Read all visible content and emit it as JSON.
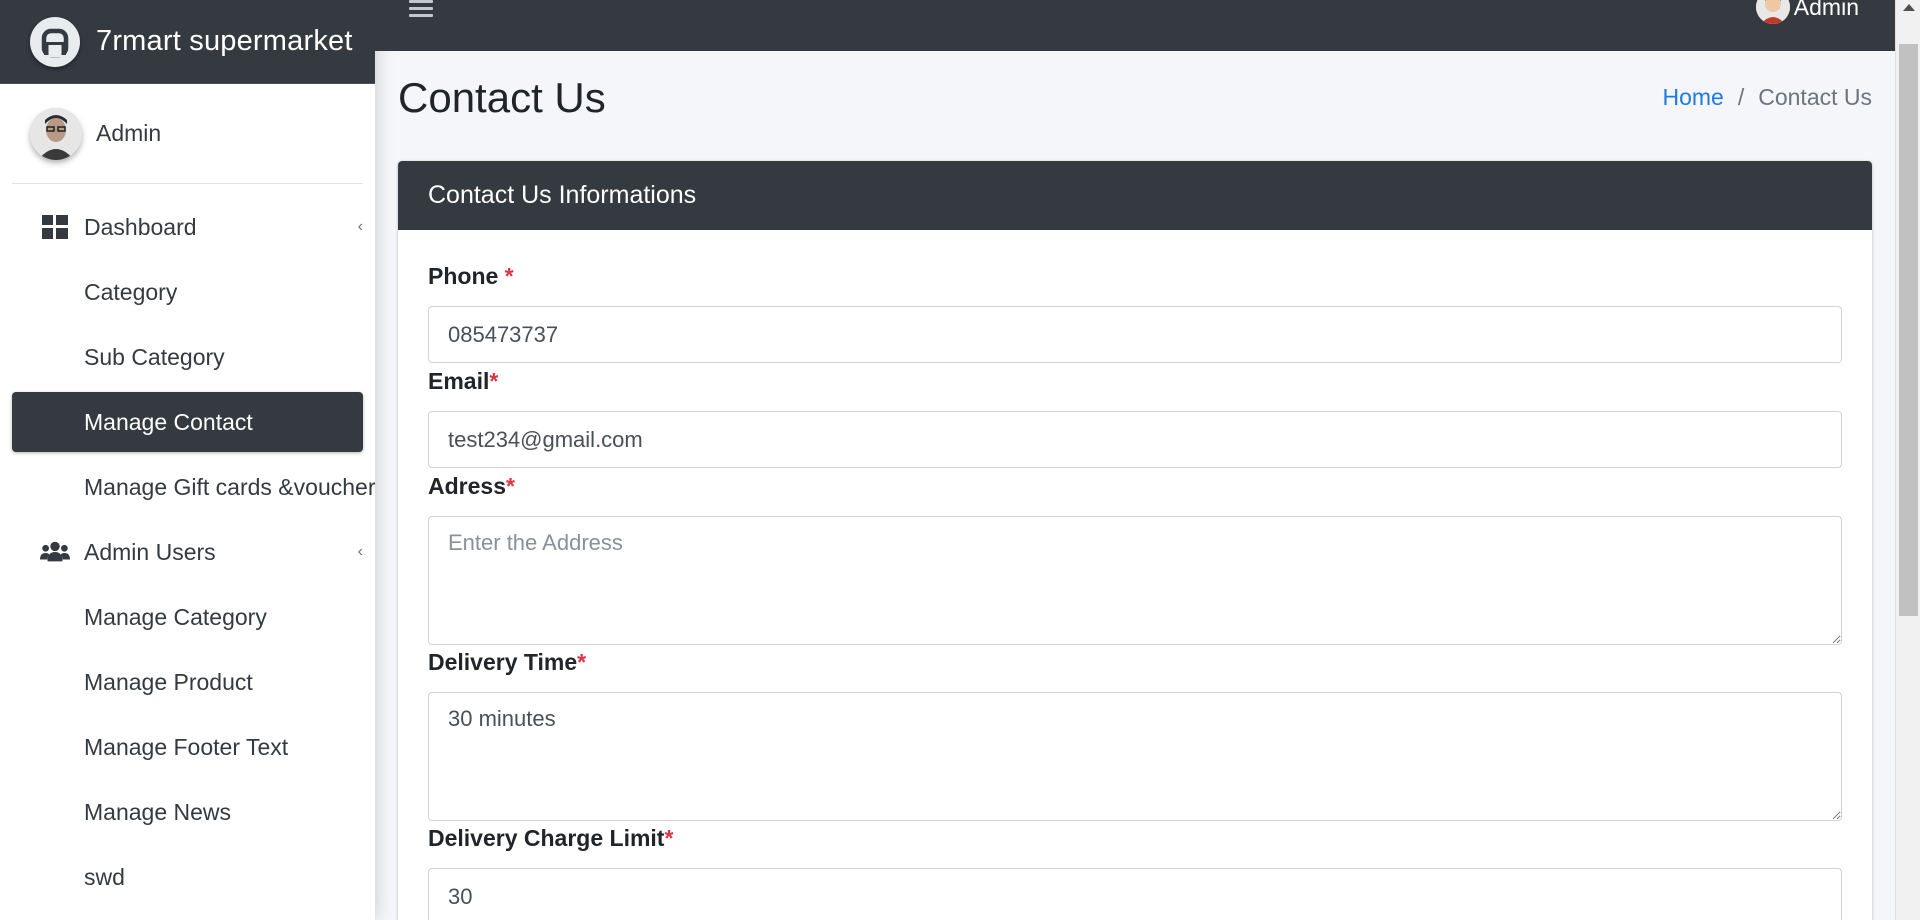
{
  "brand": {
    "name": "7rmart supermarket"
  },
  "user_panel": {
    "name": "Admin"
  },
  "sidebar": {
    "items": [
      {
        "label": "Dashboard",
        "icon": "dashboard-icon",
        "has_caret": true
      },
      {
        "label": "Category"
      },
      {
        "label": "Sub Category"
      },
      {
        "label": "Manage Contact",
        "active": true
      },
      {
        "label": "Manage Gift cards &voucher"
      },
      {
        "label": "Admin Users",
        "icon": "users-icon",
        "has_caret": true
      },
      {
        "label": "Manage Category"
      },
      {
        "label": "Manage Product"
      },
      {
        "label": "Manage Footer Text"
      },
      {
        "label": "Manage News"
      },
      {
        "label": "swd"
      }
    ]
  },
  "topbar": {
    "user_name": "Admin"
  },
  "header": {
    "title": "Contact Us"
  },
  "breadcrumb": {
    "home": "Home",
    "separator": "/",
    "current": "Contact Us"
  },
  "card": {
    "title": "Contact Us Informations"
  },
  "form": {
    "phone": {
      "label": "Phone",
      "required_mark": "*",
      "value": "085473737"
    },
    "email": {
      "label": "Email",
      "required_mark": "*",
      "value": "test234@gmail.com"
    },
    "address": {
      "label": "Adress",
      "required_mark": "*",
      "value": "",
      "placeholder": "Enter the Address"
    },
    "delivery_time": {
      "label": "Delivery Time",
      "required_mark": "*",
      "value": "30 minutes"
    },
    "delivery_charge_limit": {
      "label": "Delivery Charge Limit",
      "required_mark": "*",
      "value": "30"
    }
  },
  "colors": {
    "dark": "#343a40",
    "link": "#1f7ae0",
    "required": "#dc3545",
    "background": "#f4f6f9"
  }
}
